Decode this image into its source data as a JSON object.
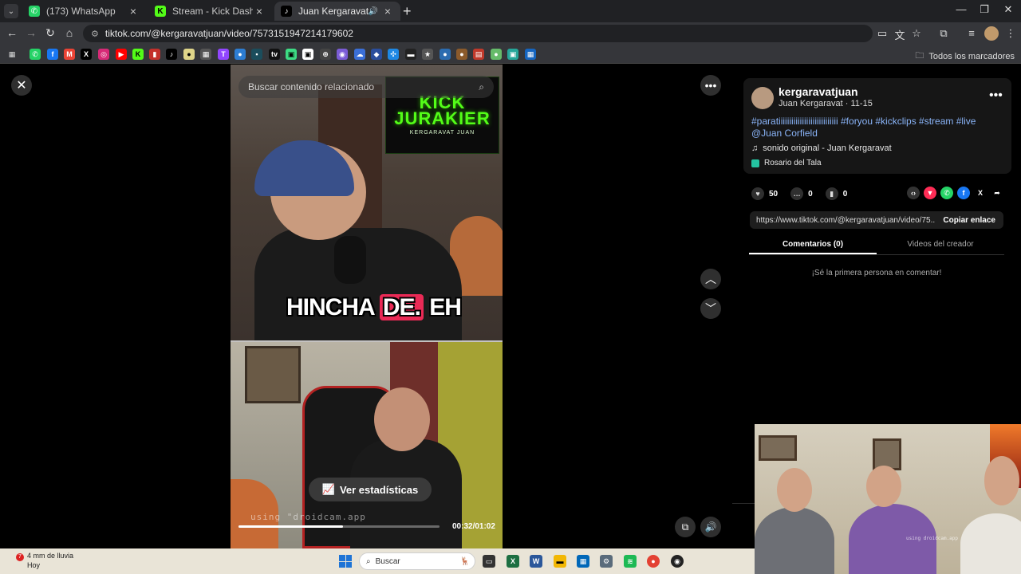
{
  "browser": {
    "tabs": [
      {
        "label": "(173) WhatsApp",
        "icon": "whatsapp-icon",
        "color": "#25d366",
        "active": false
      },
      {
        "label": "Stream - Kick Dashboard",
        "icon": "kick-icon",
        "color": "#53fc18",
        "active": false
      },
      {
        "label": "Juan Kergaravat (@kergara",
        "icon": "tiktok-icon",
        "color": "#000000",
        "active": true
      }
    ],
    "url": "tiktok.com/@kergaravatjuan/video/7573151947214179602",
    "all_bookmarks_label": "Todos los marcadores"
  },
  "video": {
    "search_placeholder": "Buscar contenido relacionado",
    "kick_logo_line1": "KICK",
    "kick_logo_line2": "JURAKIER",
    "kick_logo_sub": "KERGARAVAT JUAN",
    "caption_part1": "HINCHA",
    "caption_part2": "DE.",
    "caption_part3": "EH",
    "stats_label": "Ver estadísticas",
    "watermark": "using \"droidcam.app",
    "timecode": "00:32/01:02",
    "progress": 0.52
  },
  "creator": {
    "username": "kergaravatjuan",
    "display": "Juan Kergaravat · 11-15",
    "hashtags": "#paratiiiiiiiiiiiiiiiiiiiiiiiiiiii #foryou #kickclips #stream #live @Juan Corfield",
    "sound": "sonido original - Juan Kergaravat",
    "location": "Rosario del Tala"
  },
  "actions": {
    "likes": "50",
    "comments": "0",
    "saves": "0"
  },
  "share": {
    "link": "https://www.tiktok.com/@kergaravatjuan/video/75...",
    "copy_label": "Copiar enlace"
  },
  "panel_tabs": {
    "comments": "Comentarios (0)",
    "creator_videos": "Videos del creador",
    "empty_comments": "¡Sé la primera persona en comentar!"
  },
  "taskbar": {
    "weather_count": "7",
    "weather_line1": "4 mm de lluvia",
    "weather_line2": "Hoy",
    "search_label": "Buscar"
  },
  "webcam": {
    "watermark": "using droidcam.app"
  }
}
